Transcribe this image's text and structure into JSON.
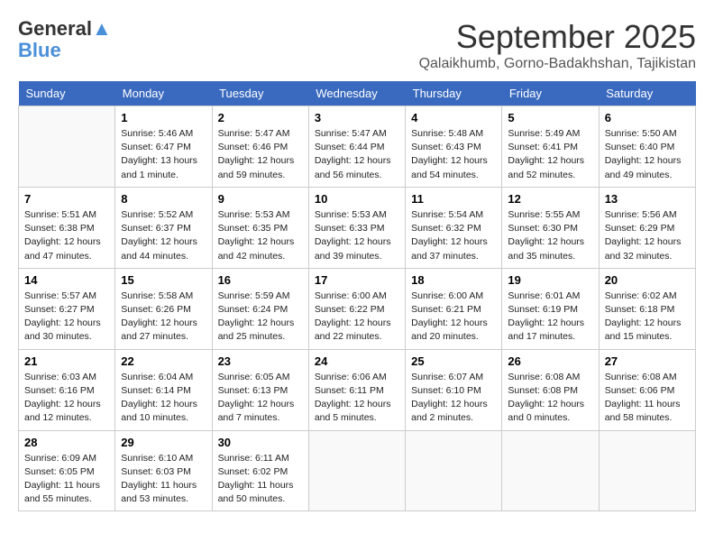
{
  "header": {
    "logo_line1": "General",
    "logo_line2": "Blue",
    "month": "September 2025",
    "location": "Qalaikhumb, Gorno-Badakhshan, Tajikistan"
  },
  "days_of_week": [
    "Sunday",
    "Monday",
    "Tuesday",
    "Wednesday",
    "Thursday",
    "Friday",
    "Saturday"
  ],
  "weeks": [
    [
      {
        "num": "",
        "info": ""
      },
      {
        "num": "1",
        "info": "Sunrise: 5:46 AM\nSunset: 6:47 PM\nDaylight: 13 hours\nand 1 minute."
      },
      {
        "num": "2",
        "info": "Sunrise: 5:47 AM\nSunset: 6:46 PM\nDaylight: 12 hours\nand 59 minutes."
      },
      {
        "num": "3",
        "info": "Sunrise: 5:47 AM\nSunset: 6:44 PM\nDaylight: 12 hours\nand 56 minutes."
      },
      {
        "num": "4",
        "info": "Sunrise: 5:48 AM\nSunset: 6:43 PM\nDaylight: 12 hours\nand 54 minutes."
      },
      {
        "num": "5",
        "info": "Sunrise: 5:49 AM\nSunset: 6:41 PM\nDaylight: 12 hours\nand 52 minutes."
      },
      {
        "num": "6",
        "info": "Sunrise: 5:50 AM\nSunset: 6:40 PM\nDaylight: 12 hours\nand 49 minutes."
      }
    ],
    [
      {
        "num": "7",
        "info": "Sunrise: 5:51 AM\nSunset: 6:38 PM\nDaylight: 12 hours\nand 47 minutes."
      },
      {
        "num": "8",
        "info": "Sunrise: 5:52 AM\nSunset: 6:37 PM\nDaylight: 12 hours\nand 44 minutes."
      },
      {
        "num": "9",
        "info": "Sunrise: 5:53 AM\nSunset: 6:35 PM\nDaylight: 12 hours\nand 42 minutes."
      },
      {
        "num": "10",
        "info": "Sunrise: 5:53 AM\nSunset: 6:33 PM\nDaylight: 12 hours\nand 39 minutes."
      },
      {
        "num": "11",
        "info": "Sunrise: 5:54 AM\nSunset: 6:32 PM\nDaylight: 12 hours\nand 37 minutes."
      },
      {
        "num": "12",
        "info": "Sunrise: 5:55 AM\nSunset: 6:30 PM\nDaylight: 12 hours\nand 35 minutes."
      },
      {
        "num": "13",
        "info": "Sunrise: 5:56 AM\nSunset: 6:29 PM\nDaylight: 12 hours\nand 32 minutes."
      }
    ],
    [
      {
        "num": "14",
        "info": "Sunrise: 5:57 AM\nSunset: 6:27 PM\nDaylight: 12 hours\nand 30 minutes."
      },
      {
        "num": "15",
        "info": "Sunrise: 5:58 AM\nSunset: 6:26 PM\nDaylight: 12 hours\nand 27 minutes."
      },
      {
        "num": "16",
        "info": "Sunrise: 5:59 AM\nSunset: 6:24 PM\nDaylight: 12 hours\nand 25 minutes."
      },
      {
        "num": "17",
        "info": "Sunrise: 6:00 AM\nSunset: 6:22 PM\nDaylight: 12 hours\nand 22 minutes."
      },
      {
        "num": "18",
        "info": "Sunrise: 6:00 AM\nSunset: 6:21 PM\nDaylight: 12 hours\nand 20 minutes."
      },
      {
        "num": "19",
        "info": "Sunrise: 6:01 AM\nSunset: 6:19 PM\nDaylight: 12 hours\nand 17 minutes."
      },
      {
        "num": "20",
        "info": "Sunrise: 6:02 AM\nSunset: 6:18 PM\nDaylight: 12 hours\nand 15 minutes."
      }
    ],
    [
      {
        "num": "21",
        "info": "Sunrise: 6:03 AM\nSunset: 6:16 PM\nDaylight: 12 hours\nand 12 minutes."
      },
      {
        "num": "22",
        "info": "Sunrise: 6:04 AM\nSunset: 6:14 PM\nDaylight: 12 hours\nand 10 minutes."
      },
      {
        "num": "23",
        "info": "Sunrise: 6:05 AM\nSunset: 6:13 PM\nDaylight: 12 hours\nand 7 minutes."
      },
      {
        "num": "24",
        "info": "Sunrise: 6:06 AM\nSunset: 6:11 PM\nDaylight: 12 hours\nand 5 minutes."
      },
      {
        "num": "25",
        "info": "Sunrise: 6:07 AM\nSunset: 6:10 PM\nDaylight: 12 hours\nand 2 minutes."
      },
      {
        "num": "26",
        "info": "Sunrise: 6:08 AM\nSunset: 6:08 PM\nDaylight: 12 hours\nand 0 minutes."
      },
      {
        "num": "27",
        "info": "Sunrise: 6:08 AM\nSunset: 6:06 PM\nDaylight: 11 hours\nand 58 minutes."
      }
    ],
    [
      {
        "num": "28",
        "info": "Sunrise: 6:09 AM\nSunset: 6:05 PM\nDaylight: 11 hours\nand 55 minutes."
      },
      {
        "num": "29",
        "info": "Sunrise: 6:10 AM\nSunset: 6:03 PM\nDaylight: 11 hours\nand 53 minutes."
      },
      {
        "num": "30",
        "info": "Sunrise: 6:11 AM\nSunset: 6:02 PM\nDaylight: 11 hours\nand 50 minutes."
      },
      {
        "num": "",
        "info": ""
      },
      {
        "num": "",
        "info": ""
      },
      {
        "num": "",
        "info": ""
      },
      {
        "num": "",
        "info": ""
      }
    ]
  ]
}
